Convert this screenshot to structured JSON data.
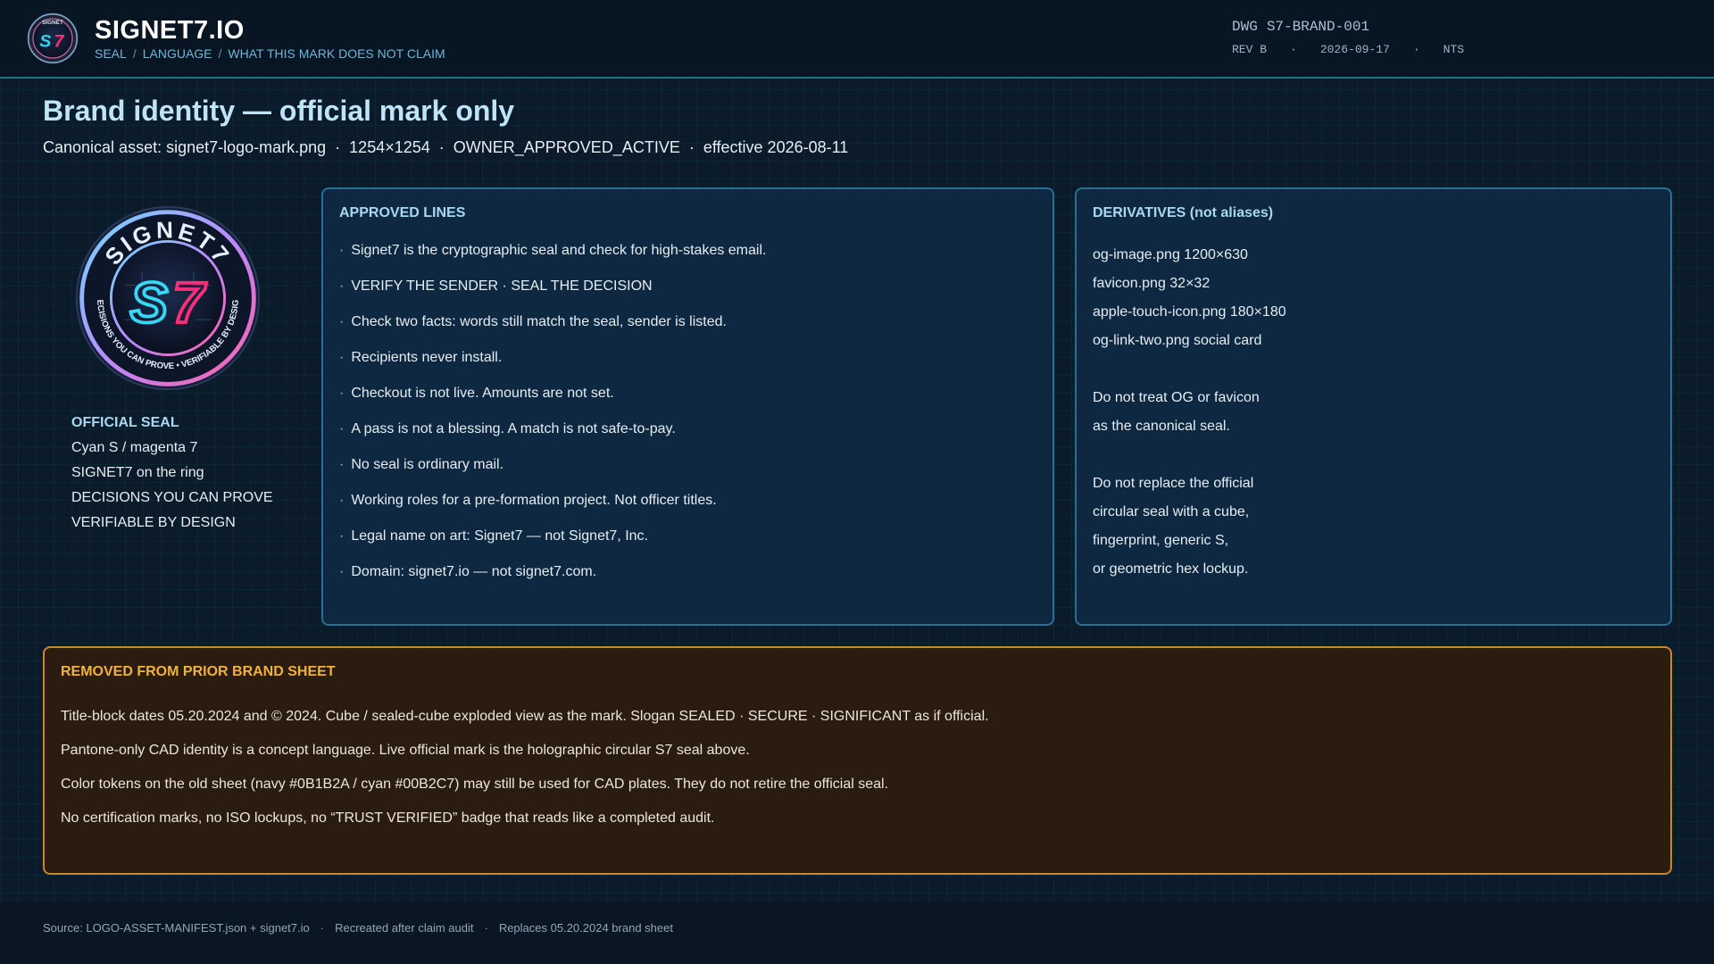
{
  "header": {
    "brand": "SIGNET7.IO",
    "breadcrumb": [
      "SEAL",
      "LANGUAGE",
      "WHAT THIS MARK DOES NOT CLAIM"
    ],
    "breadcrumb_sep": "/",
    "drawing": {
      "label": "DWG",
      "id": "S7-BRAND-001",
      "rev": "REV B",
      "date": "2026-09-17",
      "scale": "NTS"
    }
  },
  "page": {
    "title": "Brand identity — official mark only",
    "subtitle_parts": [
      "Canonical asset: signet7-logo-mark.png",
      "1254×1254",
      "OWNER_APPROVED_ACTIVE",
      "effective 2026-08-11"
    ]
  },
  "seal": {
    "ring_text": "SIGNET7",
    "monogram": "S7",
    "ring_bottom": "DECISIONS YOU CAN PROVE • VERIFIABLE BY DESIGN",
    "heading": "OFFICIAL SEAL",
    "lines": [
      "Cyan S  /  magenta 7",
      "SIGNET7 on the ring",
      "DECISIONS YOU CAN PROVE",
      "VERIFIABLE BY DESIGN"
    ]
  },
  "approved": {
    "heading": "APPROVED LINES",
    "lines": [
      "Signet7 is the cryptographic seal and check for high-stakes email.",
      "VERIFY THE SENDER  ·  SEAL THE DECISION",
      "Check two facts: words still match the seal, sender is listed.",
      "Recipients never install.",
      "Checkout is not live. Amounts are not set.",
      "A pass is not a blessing. A match is not safe-to-pay.",
      "No seal is ordinary mail.",
      "Working roles for a pre-formation project. Not officer titles.",
      "Legal name on art: Signet7 — not Signet7, Inc.",
      "Domain: signet7.io — not signet7.com."
    ]
  },
  "derivatives": {
    "heading": "DERIVATIVES  (not aliases)",
    "files": [
      "og-image.png  1200×630",
      "favicon.png  32×32",
      "apple-touch-icon.png  180×180",
      "og-link-two.png  social card"
    ],
    "note1": [
      "Do not treat OG or favicon",
      "as the canonical seal."
    ],
    "note2": [
      "Do not replace the official",
      "circular seal with a cube,",
      "fingerprint, generic S,",
      "or geometric hex lockup."
    ]
  },
  "removed": {
    "heading": "REMOVED FROM PRIOR BRAND SHEET",
    "lines": [
      "Title-block dates 05.20.2024 and © 2024.  Cube / sealed-cube exploded view as the mark.  Slogan SEALED · SECURE · SIGNIFICANT as if official.",
      "Pantone-only CAD identity is a concept language. Live official mark is the holographic circular S7 seal above.",
      "Color tokens on the old sheet (navy #0B1B2A / cyan #00B2C7) may still be used for CAD plates. They do not retire the official seal.",
      "No certification marks, no ISO lockups, no “TRUST VERIFIED” badge that reads like a completed audit."
    ]
  },
  "footer": {
    "parts": [
      "Source: LOGO-ASSET-MANIFEST.json + signet7.io",
      "Recreated after claim audit",
      "Replaces 05.20.2024 brand sheet"
    ]
  },
  "colors": {
    "navy": "#0B1B2A",
    "cyan": "#00B2C7",
    "magenta": "#FF2D78",
    "warning_border": "#C7872B",
    "warning_heading": "#F2B13A"
  }
}
